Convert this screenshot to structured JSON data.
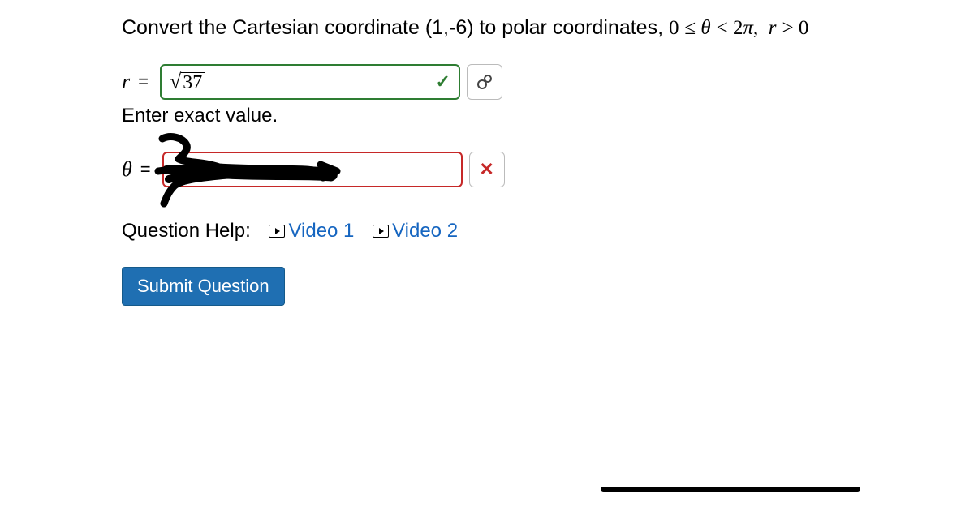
{
  "question": {
    "prefix": "Convert the Cartesian coordinate (1,-6) to polar coordinates, ",
    "math": "0 ≤ θ < 2π,  r > 0"
  },
  "r_row": {
    "var": "r",
    "eq": "=",
    "value_num": "37",
    "correct": true
  },
  "hint": "Enter exact value.",
  "theta_row": {
    "var": "θ",
    "eq": "=",
    "correct": false
  },
  "help": {
    "label": "Question Help:",
    "video1": "Video 1",
    "video2": "Video 2"
  },
  "submit_label": "Submit Question",
  "icons": {
    "check": "✓",
    "cross": "✕"
  }
}
